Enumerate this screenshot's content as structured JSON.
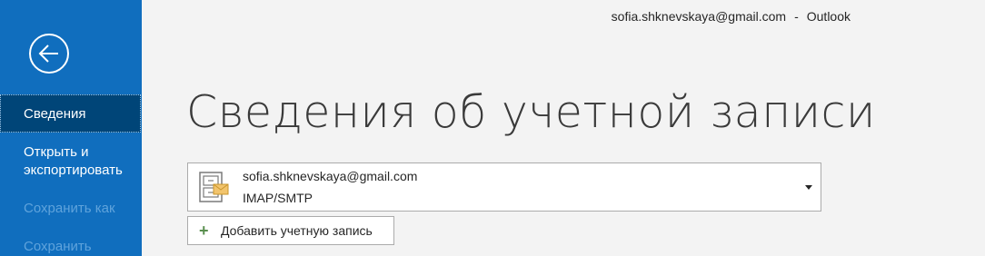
{
  "titlebar": {
    "account": "sofia.shknevskaya@gmail.com",
    "separator": "-",
    "app": "Outlook"
  },
  "sidebar": {
    "back_icon": "arrow-left-circle-icon",
    "items": [
      {
        "label": "Сведения",
        "state": "active"
      },
      {
        "label": "Открыть и",
        "label2": "экспортировать",
        "state": "normal"
      },
      {
        "label": "Сохранить как",
        "state": "disabled"
      },
      {
        "label": "Сохранить",
        "state": "disabled"
      }
    ]
  },
  "main": {
    "title": "Сведения об учетной записи",
    "account_select": {
      "email": "sofia.shknevskaya@gmail.com",
      "type": "IMAP/SMTP",
      "icon": "mail-account-icon"
    },
    "add_account_label": "Добавить учетную запись"
  },
  "colors": {
    "sidebar": "#106ebe",
    "sidebar_active": "#004578",
    "disabled_text": "#5fa3dc",
    "plus": "#5a8f4f"
  }
}
